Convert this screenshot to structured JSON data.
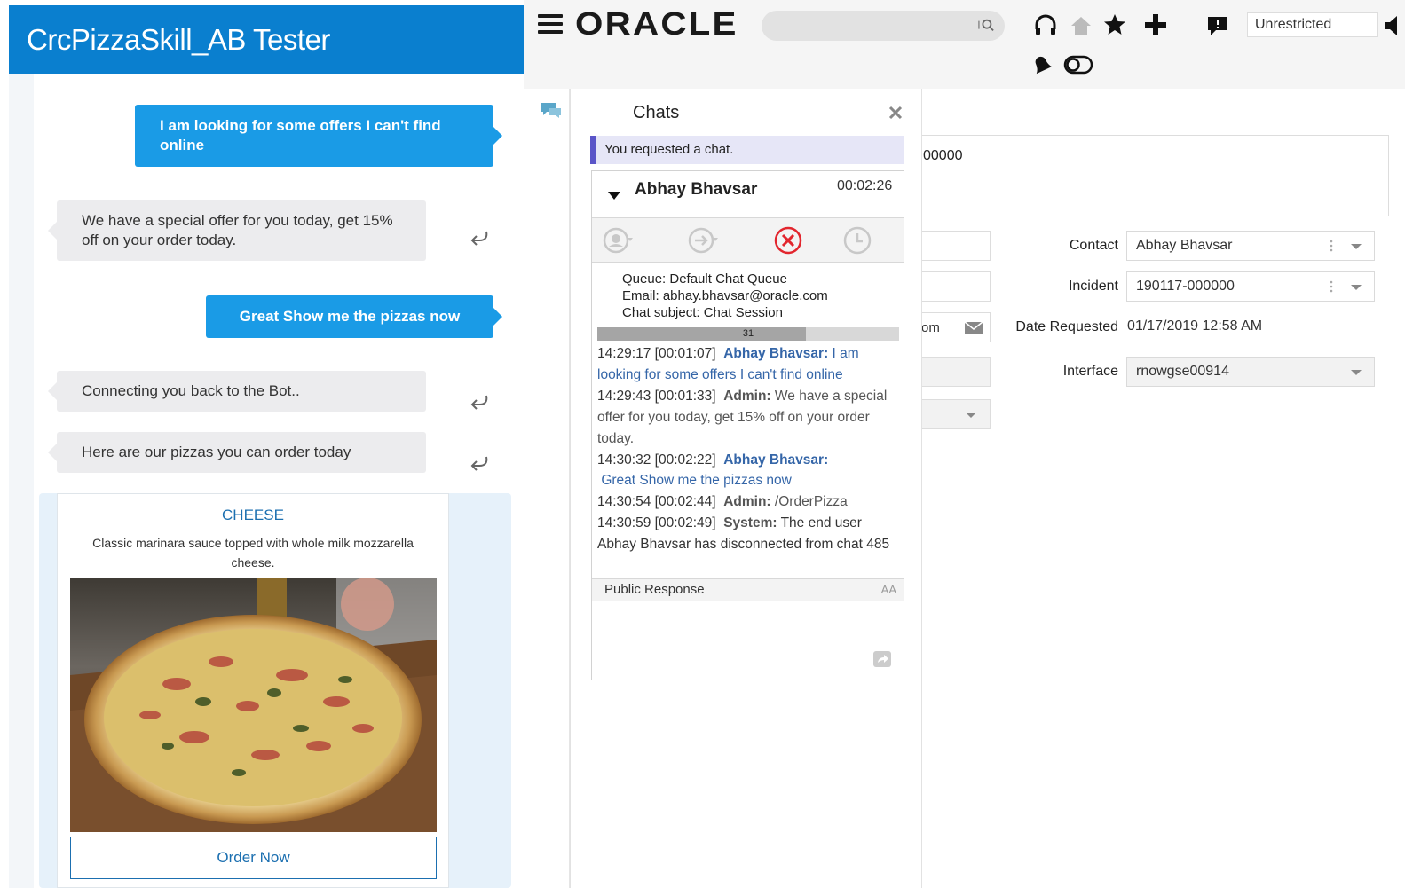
{
  "tester": {
    "title": "CrcPizzaSkill_AB Tester",
    "messages": [
      {
        "from": "user",
        "text": "I am looking for some offers I can't find online"
      },
      {
        "from": "bot",
        "text": "We have a special offer for you today, get 15% off on your order today."
      },
      {
        "from": "user",
        "text": "Great Show me the pizzas now"
      },
      {
        "from": "bot",
        "text": "Connecting you back to the Bot.."
      },
      {
        "from": "bot",
        "text": "Here are our pizzas you can order today"
      }
    ],
    "card": {
      "title": "CHEESE",
      "description": "Classic marinara sauce topped with whole milk mozzarella cheese.",
      "button_label": "Order Now"
    }
  },
  "oracle": {
    "logo": "ORACLE",
    "search_placeholder": "",
    "site_selector": "Unrestricted",
    "icons": [
      "hamburger-menu-icon",
      "headset-icon",
      "home-icon",
      "star-icon",
      "plus-icon",
      "feedback-icon",
      "speaker-icon",
      "bell-icon",
      "toggle-icon"
    ],
    "chats": {
      "title": "Chats",
      "requested_notice": "You requested a chat.",
      "session": {
        "customer": "Abhay Bhavsar",
        "elapsed": "00:02:26",
        "queue": "Queue: Default Chat Queue",
        "email": "Email: abhay.bhavsar@oracle.com",
        "subject": "Chat subject: Chat Session",
        "progress_label": "31",
        "progress_fraction": 0.69,
        "transcript": [
          {
            "stamp": "14:29:17 [00:01:07]",
            "who": "Abhay Bhavsar:",
            "text": "I am looking for some offers I can't find online"
          },
          {
            "stamp": "14:29:43 [00:01:33]",
            "who": "Admin:",
            "text": "We have a special offer for you today, get 15% off on your order today."
          },
          {
            "stamp": "14:30:32 [00:02:22]",
            "who": "Abhay Bhavsar:",
            "text": "Great Show me the pizzas now"
          },
          {
            "stamp": "14:30:54 [00:02:44]",
            "who": "Admin:",
            "text": "/OrderPizza"
          },
          {
            "stamp": "14:30:59 [00:02:49]",
            "who": "System:",
            "text": "The end user Abhay Bhavsar has disconnected from chat 485"
          }
        ],
        "response_label": "Public Response",
        "font_size_label": "AA"
      }
    },
    "workspace": {
      "header_value": "00000",
      "partial_email_value": "om",
      "fields": [
        {
          "label": "Contact",
          "value": "Abhay Bhavsar"
        },
        {
          "label": "Incident",
          "value": "190117-000000"
        },
        {
          "label": "Date Requested",
          "value": "01/17/2019 12:58 AM"
        },
        {
          "label": "Interface",
          "value": "rnowgse00914"
        }
      ]
    }
  }
}
